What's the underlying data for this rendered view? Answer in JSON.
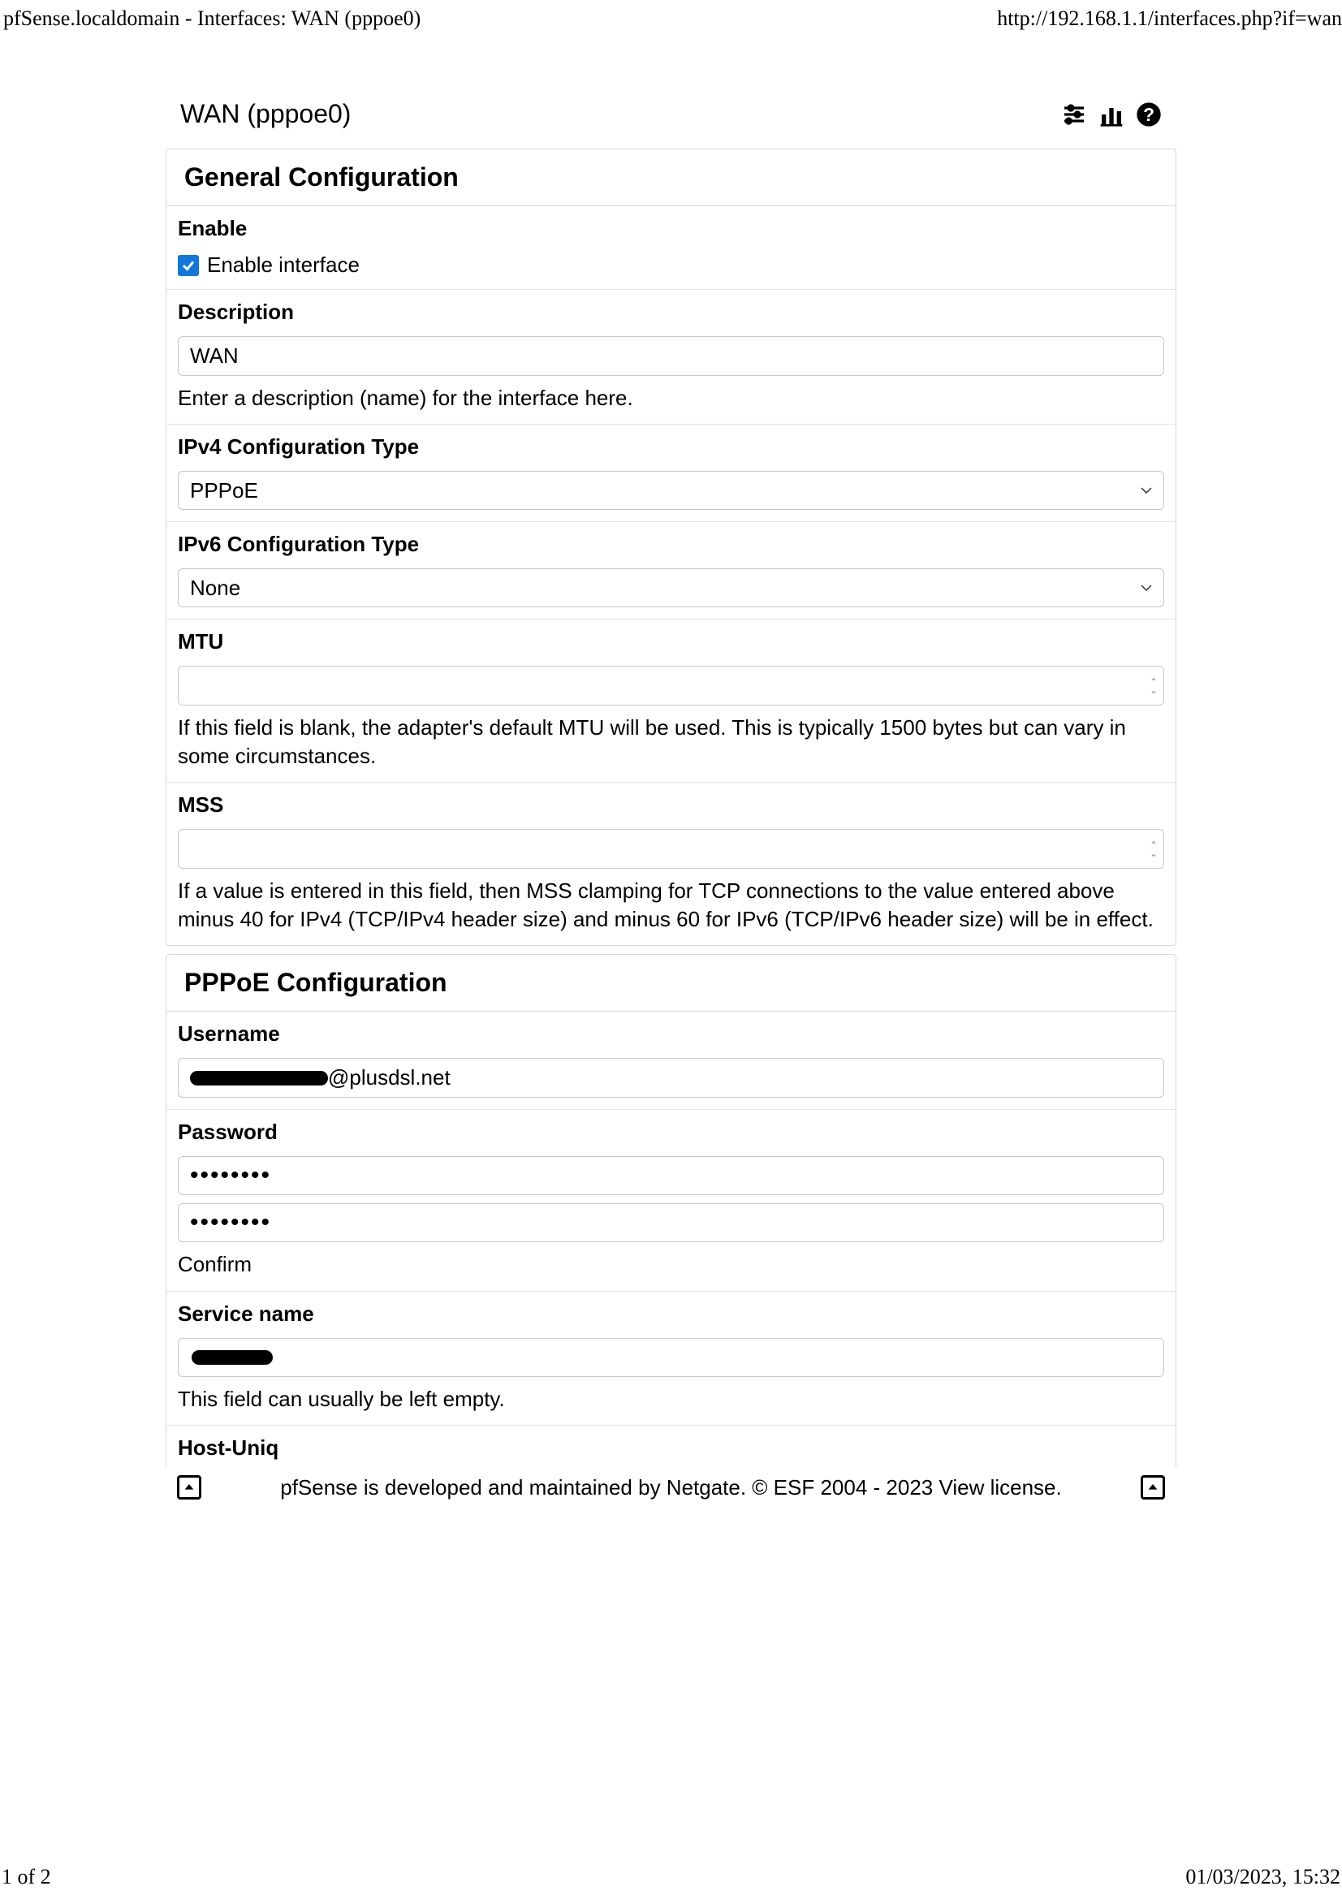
{
  "browser": {
    "title": "pfSense.localdomain - Interfaces: WAN (pppoe0)",
    "url": "http://192.168.1.1/interfaces.php?if=wan"
  },
  "page": {
    "title": "WAN (pppoe0)"
  },
  "panels": {
    "general": {
      "heading": "General Configuration",
      "enable": {
        "label": "Enable",
        "checkbox_label": "Enable interface",
        "checked": true
      },
      "description": {
        "label": "Description",
        "value": "WAN",
        "help": "Enter a description (name) for the interface here."
      },
      "ipv4type": {
        "label": "IPv4 Configuration Type",
        "value": "PPPoE"
      },
      "ipv6type": {
        "label": "IPv6 Configuration Type",
        "value": "None"
      },
      "mtu": {
        "label": "MTU",
        "value": "",
        "help": "If this field is blank, the adapter's default MTU will be used. This is typically 1500 bytes but can vary in some circumstances."
      },
      "mss": {
        "label": "MSS",
        "value": "",
        "help": "If a value is entered in this field, then MSS clamping for TCP connections to the value entered above minus 40 for IPv4 (TCP/IPv4 header size) and minus 60 for IPv6 (TCP/IPv6 header size) will be in effect."
      }
    },
    "pppoe": {
      "heading": "PPPoE Configuration",
      "username": {
        "label": "Username",
        "suffix": "@plusdsl.net"
      },
      "password": {
        "label": "Password",
        "value": "••••••••",
        "confirm_value": "••••••••",
        "confirm_label": "Confirm"
      },
      "servicename": {
        "label": "Service name",
        "help": "This field can usually be left empty."
      },
      "hostuniq": {
        "label": "Host-Uniq"
      }
    }
  },
  "footer": {
    "text": "pfSense is developed and maintained by Netgate. © ESF 2004 - 2023 View license."
  },
  "print": {
    "page": "1 of 2",
    "datetime": "01/03/2023, 15:32"
  }
}
